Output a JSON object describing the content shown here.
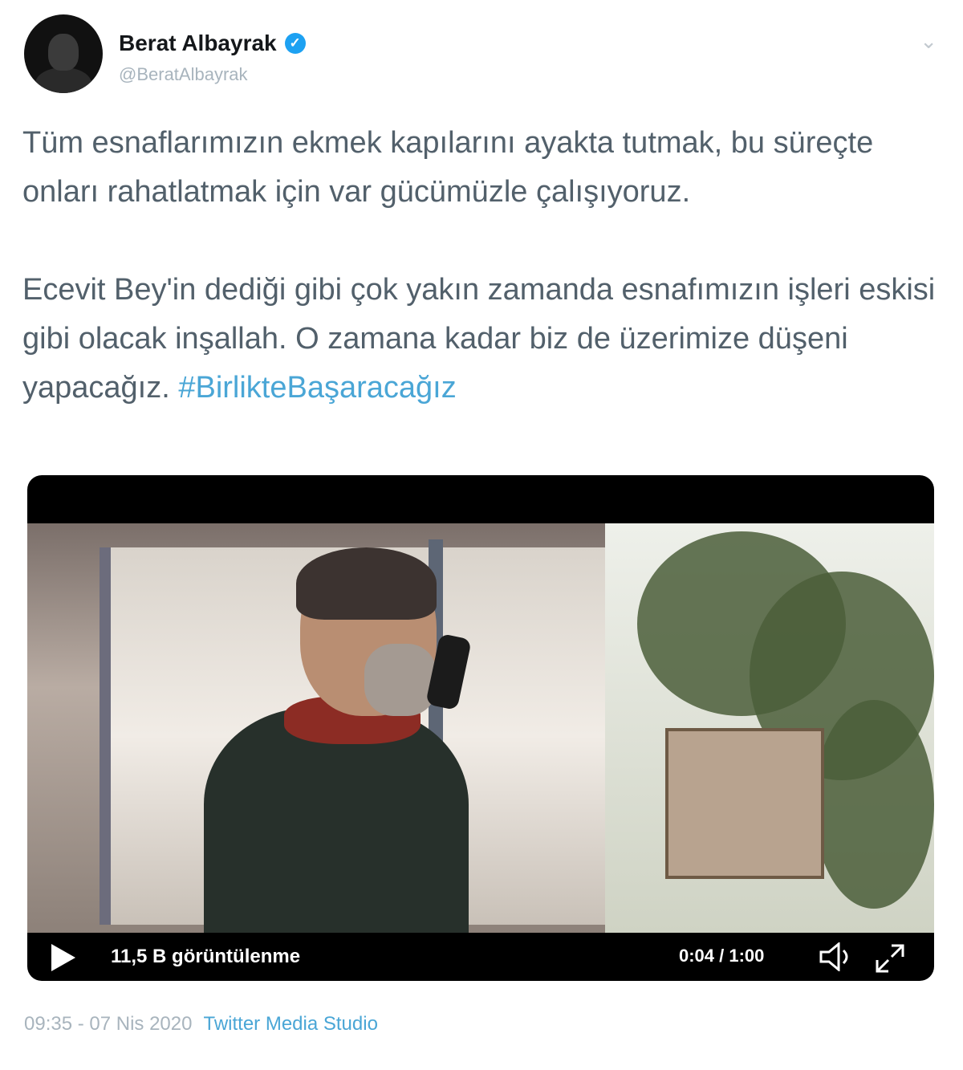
{
  "author": {
    "display_name": "Berat Albayrak",
    "handle": "@BeratAlbayrak",
    "verified_mark": "✓"
  },
  "more_icon": "⌄",
  "tweet": {
    "text": "Tüm esnaflarımızın ekmek kapılarını ayakta tutmak, bu süreçte onları rahatlatmak için var gücümüzle çalışıyoruz.\n\nEcevit Bey'in dediği gibi çok yakın zamanda esnafımızın işleri eskisi gibi olacak inşallah. O zamana kadar biz de üzerimize düşeni yapacağız. ",
    "hashtag": "#BirlikteBaşaracağız"
  },
  "video": {
    "views": "11,5 B görüntülenme",
    "time": "0:04 / 1:00",
    "progress": 0.07
  },
  "footer": {
    "timestamp": "09:35 - 07 Nis 2020",
    "source": "Twitter Media Studio"
  },
  "colors": {
    "link": "#4aa6d6",
    "verified": "#1da1f2",
    "muted": "#a8b4bd"
  },
  "icons": [
    "avatar",
    "verified-badge-icon",
    "chevron-down-icon",
    "play-icon",
    "volume-icon",
    "fullscreen-icon"
  ]
}
